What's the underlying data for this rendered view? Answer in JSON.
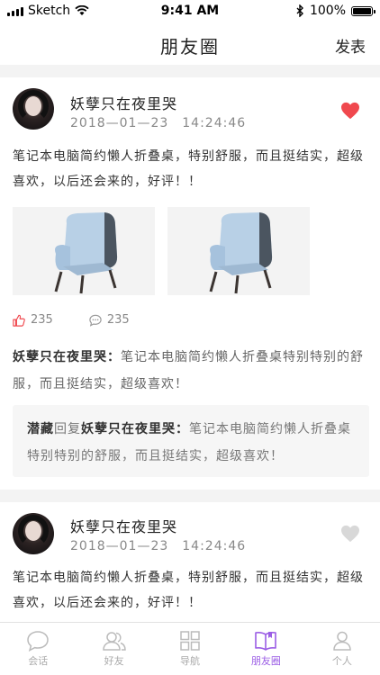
{
  "status_bar": {
    "carrier": "Sketch",
    "time": "9:41 AM",
    "battery": "100%",
    "battery_level": 1.0
  },
  "nav": {
    "title": "朋友圈",
    "action": "发表"
  },
  "posts": [
    {
      "name": "妖孽只在夜里哭",
      "time": "2018—01—23　14:24:46",
      "liked": true,
      "content": "笔记本电脑简约懒人折叠桌，特别舒服，而且挺结实，超级喜欢，以后还会来的，好评！！",
      "likes": "235",
      "comments": "235",
      "comment": {
        "author": "妖孽只在夜里哭：",
        "text": "笔记本电脑简约懒人折叠桌特别特别的舒服，而且挺结实，超级喜欢！"
      },
      "reply": {
        "from": "潜藏",
        "verb": "回复",
        "to": "妖孽只在夜里哭：",
        "text": "笔记本电脑简约懒人折叠桌特别特别的舒服，而且挺结实，超级喜欢！"
      }
    },
    {
      "name": "妖孽只在夜里哭",
      "time": "2018—01—23　14:24:46",
      "liked": false,
      "content": "笔记本电脑简约懒人折叠桌，特别舒服，而且挺结实，超级喜欢，以后还会来的，好评！！"
    }
  ],
  "tabs": [
    {
      "label": "会话",
      "icon": "chat-icon",
      "active": false
    },
    {
      "label": "好友",
      "icon": "friends-icon",
      "active": false
    },
    {
      "label": "导航",
      "icon": "grid-icon",
      "active": false
    },
    {
      "label": "朋友圈",
      "icon": "book-icon",
      "active": true
    },
    {
      "label": "个人",
      "icon": "person-icon",
      "active": false
    }
  ],
  "colors": {
    "accent": "#9b5de5",
    "like_red": "#f0484e",
    "like_grey": "#d8d8d8",
    "thumb_red": "#f0484e"
  }
}
